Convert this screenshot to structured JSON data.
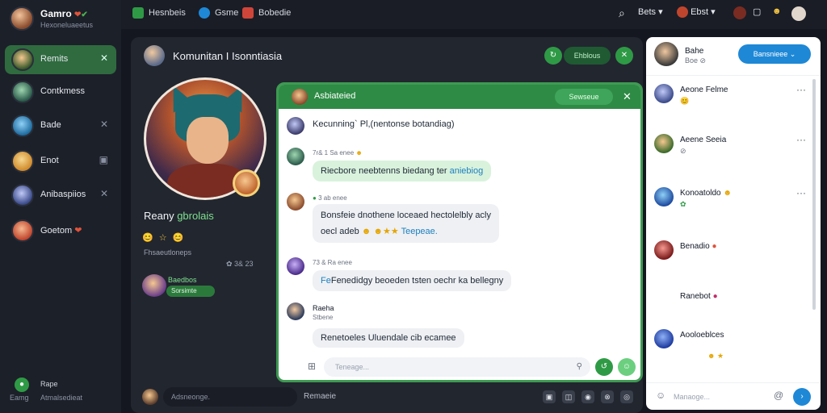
{
  "brand": {
    "title": "Gamro",
    "subtitle": "Hexoneluaeetus"
  },
  "sidebar": {
    "items": [
      {
        "label": "Remits",
        "active": true
      },
      {
        "label": "Contkmess",
        "active": false
      },
      {
        "label": "Bade",
        "active": false
      },
      {
        "label": "Enot",
        "active": false
      },
      {
        "label": "Anibaspiios",
        "active": false
      },
      {
        "label": "Goetom",
        "active": false
      }
    ],
    "footer": {
      "line1": "Rape",
      "line2": "Eamg",
      "line3": "Atmalsedieat"
    }
  },
  "topbar": {
    "nav": [
      {
        "label": "Hesnbeis",
        "icon": "leaf-icon"
      },
      {
        "label": "Gsme",
        "icon": "shield-icon"
      },
      {
        "label": "Bobedie",
        "icon": "game-icon"
      }
    ],
    "right": {
      "lang": "Bets",
      "user": "Ebst"
    }
  },
  "main": {
    "title": "Komunitan I Isonntiasia",
    "pill": "Ehblous",
    "profile": {
      "name_prefix": "Reany ",
      "name_highlight": "gbrolais",
      "emojis": "😊 ☆ 😊",
      "sub": "Fhsaeutloneps",
      "count": "✿ 3& 23",
      "mini_tag": "Baedbos",
      "mini_pill": "Sorsimte"
    },
    "footer": {
      "input": "Adsneonge.",
      "label": "Remaeie"
    }
  },
  "chat": {
    "title": "Asbiateied",
    "pill": "Sewseue",
    "close": "✕",
    "messages": [
      {
        "meta": "",
        "text": "Kecunning`  Pl,(nentonse botandiag)"
      },
      {
        "meta": "7r& 1 Sa enee",
        "text_a": "Riecbore neebtenns biedang ter",
        "text_b": "aniebiog"
      },
      {
        "meta": "3 ab enee",
        "text_a": "Bonsfeie dnothene loceaed hectolelbly acly",
        "text_c": "oecl adeb",
        "text_d": "Teepeae."
      },
      {
        "meta": "73 & Ra enee",
        "text": "Fenedidgy beoeden tsten oechr ka bellegny"
      },
      {
        "meta": "Stbene",
        "name": "Raeha",
        "text": "Renetoeles Uluendale cib ecamee"
      }
    ],
    "input_placeholder": "Teneage..."
  },
  "right": {
    "header": {
      "name": "Bahe",
      "status": "Boe",
      "button": "Bansnieee"
    },
    "contacts": [
      {
        "name": "Aeone Felme",
        "status": "😊",
        "sub": ""
      },
      {
        "name": "Aeene Seeia",
        "status": "⊘",
        "sub": ""
      },
      {
        "name": "Konoatoldo",
        "status": "✿",
        "sub": ""
      },
      {
        "name": "Benadio",
        "status": "",
        "sub": ""
      },
      {
        "name": "Ranebot",
        "status": "",
        "sub": ""
      },
      {
        "name": "Aooloeblces",
        "status": "",
        "sub": ""
      }
    ],
    "input": "Manaoge..."
  }
}
